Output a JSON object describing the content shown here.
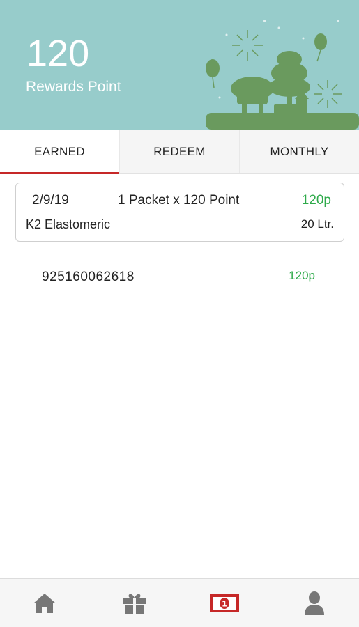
{
  "rewards": {
    "points": "120",
    "label": "Rewards Point"
  },
  "tabs": [
    {
      "label": "EARNED",
      "active": true
    },
    {
      "label": "REDEEM",
      "active": false
    },
    {
      "label": "MONTHLY",
      "active": false
    }
  ],
  "transaction": {
    "date": "2/9/19",
    "quantity": "1 Packet x 120 Point",
    "points": "120p",
    "product": "K2 Elastomeric",
    "volume": "20 Ltr."
  },
  "codes": [
    {
      "code": "925160062618",
      "points": "120p"
    }
  ],
  "bottom_nav": [
    {
      "icon": "home-icon"
    },
    {
      "icon": "gift-icon"
    },
    {
      "icon": "rewards-money-icon",
      "active": true
    },
    {
      "icon": "profile-icon"
    }
  ],
  "colors": {
    "header_bg": "#97cccb",
    "accent_red": "#c62828",
    "points_green": "#2eaa4a",
    "illustration_green": "#6a9a5e"
  }
}
